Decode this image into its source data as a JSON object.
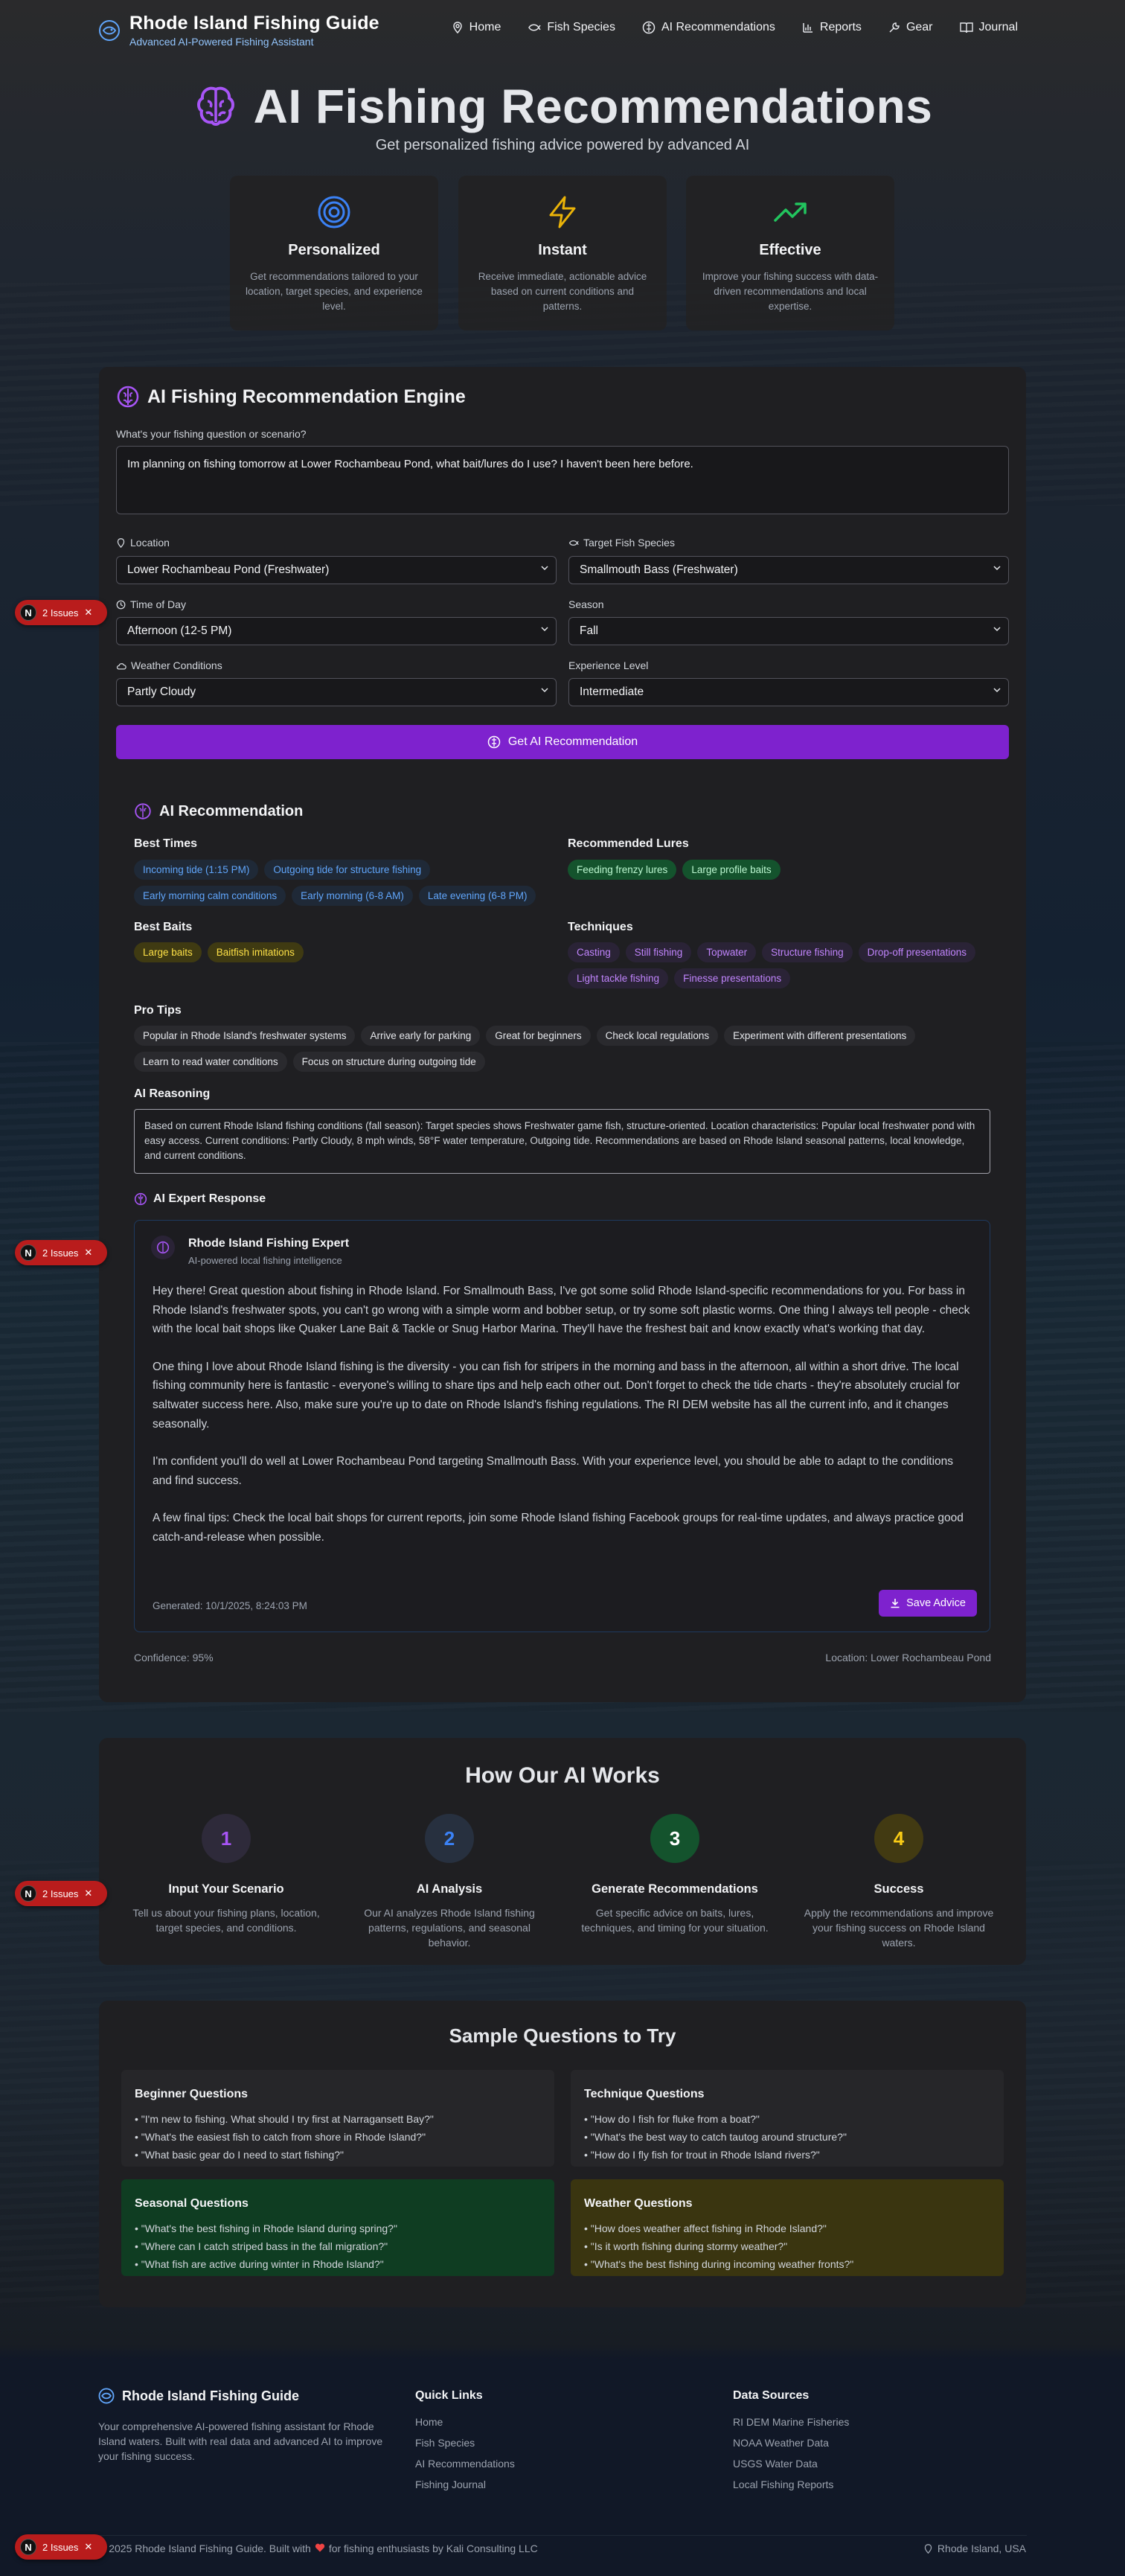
{
  "nav": {
    "brand_title": "Rhode Island Fishing Guide",
    "brand_subtitle": "Advanced AI-Powered Fishing Assistant",
    "links": [
      "Home",
      "Fish Species",
      "AI Recommendations",
      "Reports",
      "Gear",
      "Journal"
    ]
  },
  "hero": {
    "title": "AI Fishing Recommendations",
    "subtitle": "Get personalized fishing advice powered by advanced AI",
    "features": [
      {
        "title": "Personalized",
        "text": "Get recommendations tailored to your location, target species, and experience level.",
        "icon": "target-icon",
        "color": "#3b82f6"
      },
      {
        "title": "Instant",
        "text": "Receive immediate, actionable advice based on current conditions and patterns.",
        "icon": "lightning-icon",
        "color": "#eab308"
      },
      {
        "title": "Effective",
        "text": "Improve your fishing success with data-driven recommendations and local expertise.",
        "icon": "trending-up-icon",
        "color": "#22c55e"
      }
    ]
  },
  "engine": {
    "title": "AI Fishing Recommendation Engine",
    "question_label": "What's your fishing question or scenario?",
    "question_value": "Im planning on fishing tomorrow at Lower Rochambeau Pond, what bait/lures do I use? I haven't been here before.",
    "location_label": "Location",
    "location_value": "Lower Rochambeau Pond (Freshwater)",
    "species_label": "Target Fish Species",
    "species_value": "Smallmouth Bass (Freshwater)",
    "time_label": "Time of Day",
    "time_value": "Afternoon (12-5 PM)",
    "season_label": "Season",
    "season_value": "Fall",
    "weather_label": "Weather Conditions",
    "weather_value": "Partly Cloudy",
    "experience_label": "Experience Level",
    "experience_value": "Intermediate",
    "submit_label": "Get AI Recommendation"
  },
  "recommendation": {
    "title": "AI Recommendation",
    "best_times_label": "Best Times",
    "best_times": [
      "Incoming tide (1:15 PM)",
      "Outgoing tide for structure fishing",
      "Early morning calm conditions",
      "Early morning (6-8 AM)",
      "Late evening (6-8 PM)"
    ],
    "lures_label": "Recommended Lures",
    "lures": [
      "Feeding frenzy lures",
      "Large profile baits"
    ],
    "baits_label": "Best Baits",
    "baits": [
      "Large baits",
      "Baitfish imitations"
    ],
    "techniques_label": "Techniques",
    "techniques": [
      "Casting",
      "Still fishing",
      "Topwater",
      "Structure fishing",
      "Drop-off presentations",
      "Light tackle fishing",
      "Finesse presentations"
    ],
    "tips_label": "Pro Tips",
    "tips": [
      "Popular in Rhode Island's freshwater systems",
      "Arrive early for parking",
      "Great for beginners",
      "Check local regulations",
      "Experiment with different presentations",
      "Learn to read water conditions",
      "Focus on structure during outgoing tide"
    ],
    "reasoning_label": "AI Reasoning",
    "reasoning": "Based on current Rhode Island fishing conditions (fall season): Target species shows Freshwater game fish, structure-oriented. Location characteristics: Popular local freshwater pond with easy access. Current conditions: Partly Cloudy, 8 mph winds, 58°F water temperature, Outgoing tide. Recommendations are based on Rhode Island seasonal patterns, local knowledge, and current conditions.",
    "expert_label": "AI Expert Response",
    "expert_name": "Rhode Island Fishing Expert",
    "expert_sub": "AI-powered local fishing intelligence",
    "expert_paragraphs": [
      "Hey there! Great question about fishing in Rhode Island. For Smallmouth Bass, I've got some solid Rhode Island-specific recommendations for you. For bass in Rhode Island's freshwater spots, you can't go wrong with a simple worm and bobber setup, or try some soft plastic worms. One thing I always tell people - check with the local bait shops like Quaker Lane Bait & Tackle or Snug Harbor Marina. They'll have the freshest bait and know exactly what's working that day.",
      "One thing I love about Rhode Island fishing is the diversity - you can fish for stripers in the morning and bass in the afternoon, all within a short drive. The local fishing community here is fantastic - everyone's willing to share tips and help each other out. Don't forget to check the tide charts - they're absolutely crucial for saltwater success here. Also, make sure you're up to date on Rhode Island's fishing regulations. The RI DEM website has all the current info, and it changes seasonally.",
      "I'm confident you'll do well at Lower Rochambeau Pond targeting Smallmouth Bass. With your experience level, you should be able to adapt to the conditions and find success.",
      "A few final tips: Check the local bait shops for current reports, join some Rhode Island fishing Facebook groups for real-time updates, and always practice good catch-and-release when possible."
    ],
    "generated": "Generated: 10/1/2025, 8:24:03 PM",
    "save_label": "Save Advice",
    "confidence": "Confidence: 95%",
    "location": "Location: Lower Rochambeau Pond"
  },
  "issues_badge": {
    "label": "2 Issues",
    "letter": "N"
  },
  "how": {
    "title": "How Our AI Works",
    "steps": [
      {
        "num": "1",
        "title": "Input Your Scenario",
        "text": "Tell us about your fishing plans, location, target species, and conditions.",
        "color": "#a855f7",
        "bg": "#2e2a3a"
      },
      {
        "num": "2",
        "title": "AI Analysis",
        "text": "Our AI analyzes Rhode Island fishing patterns, regulations, and seasonal behavior.",
        "color": "#3b82f6",
        "bg": "#27303f"
      },
      {
        "num": "3",
        "title": "Generate Recommendations",
        "text": "Get specific advice on baits, lures, techniques, and timing for your situation.",
        "color": "#ffffff",
        "bg": "#14532d"
      },
      {
        "num": "4",
        "title": "Success",
        "text": "Apply the recommendations and improve your fishing success on Rhode Island waters.",
        "color": "#facc15",
        "bg": "#423a12"
      }
    ]
  },
  "samples": {
    "title": "Sample Questions to Try",
    "groups": [
      {
        "title": "Beginner Questions",
        "items": [
          "• \"I'm new to fishing. What should I try first at Narragansett Bay?\"",
          "• \"What's the easiest fish to catch from shore in Rhode Island?\"",
          "• \"What basic gear do I need to start fishing?\""
        ]
      },
      {
        "title": "Technique Questions",
        "items": [
          "• \"How do I fish for fluke from a boat?\"",
          "• \"What's the best way to catch tautog around structure?\"",
          "• \"How do I fly fish for trout in Rhode Island rivers?\""
        ]
      },
      {
        "title": "Seasonal Questions",
        "items": [
          "• \"What's the best fishing in Rhode Island during spring?\"",
          "• \"Where can I catch striped bass in the fall migration?\"",
          "• \"What fish are active during winter in Rhode Island?\""
        ]
      },
      {
        "title": "Weather Questions",
        "items": [
          "• \"How does weather affect fishing in Rhode Island?\"",
          "• \"Is it worth fishing during stormy weather?\"",
          "• \"What's the best fishing during incoming weather fronts?\""
        ]
      }
    ]
  },
  "footer": {
    "brand": "Rhode Island Fishing Guide",
    "about": "Your comprehensive AI-powered fishing assistant for Rhode Island waters. Built with real data and advanced AI to improve your fishing success.",
    "quick_links_title": "Quick Links",
    "quick_links": [
      "Home",
      "Fish Species",
      "AI Recommendations",
      "Fishing Journal"
    ],
    "data_sources_title": "Data Sources",
    "data_sources": [
      "RI DEM Marine Fisheries",
      "NOAA Weather Data",
      "USGS Water Data",
      "Local Fishing Reports"
    ],
    "copyright_a": "© 2025 Rhode Island Fishing Guide. Built with",
    "copyright_b": "for fishing enthusiasts by Kali Consulting LLC",
    "region": "Rhode Island, USA"
  }
}
